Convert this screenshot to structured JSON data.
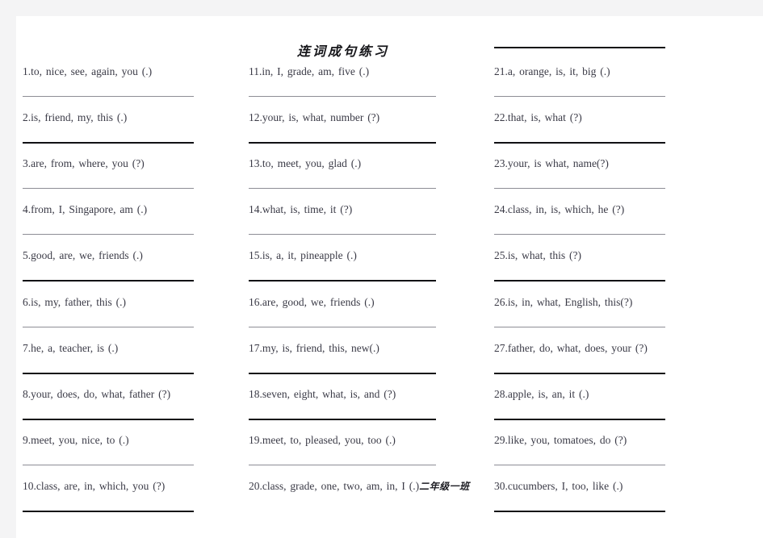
{
  "document": {
    "title": "连词成句练习",
    "page_background": "#ffffff",
    "canvas_background": "#f4f4f5",
    "text_color": "#3a3a46",
    "rule_color": "#8d8d95",
    "rule_heavy_color": "#101014"
  },
  "columns": [
    {
      "id": "column-1",
      "has_leading_rule": false,
      "has_trailing_rule": true,
      "items": [
        {
          "number": "1.",
          "text": "1.to, nice, see, again, you (.)",
          "rule": "light"
        },
        {
          "number": "2.",
          "text": "2.is, friend, my, this (.)",
          "rule": "heavy"
        },
        {
          "number": "3.",
          "text": "3.are, from, where, you (?)",
          "rule": "light"
        },
        {
          "number": "4.",
          "text": "4.from, I, Singapore, am (.)",
          "rule": "light"
        },
        {
          "number": "5.",
          "text": "5.good, are, we, friends (.)",
          "rule": "heavy"
        },
        {
          "number": "6.",
          "text": "6.is, my, father, this (.)",
          "rule": "light"
        },
        {
          "number": "7.",
          "text": "7.he, a, teacher, is (.)",
          "rule": "heavy"
        },
        {
          "number": "8.",
          "text": "8.your, does, do, what, father (?)",
          "rule": "heavy"
        },
        {
          "number": "9.",
          "text": "9.meet, you, nice, to (.)",
          "rule": "light"
        },
        {
          "number": "10.",
          "text": "10.class, are, in, which, you (?)",
          "rule": "heavy"
        }
      ]
    },
    {
      "id": "column-2",
      "has_leading_rule": false,
      "has_trailing_rule": false,
      "items": [
        {
          "number": "11.",
          "text": "11.in, I, grade, am, five (.)",
          "rule": "light"
        },
        {
          "number": "12.",
          "text": "12.your, is, what, number (?)",
          "rule": "heavy"
        },
        {
          "number": "13.",
          "text": "13.to, meet, you, glad (.)",
          "rule": "light"
        },
        {
          "number": "14.",
          "text": "14.what, is, time, it (?)",
          "rule": "light"
        },
        {
          "number": "15.",
          "text": "15.is, a, it, pineapple (.)",
          "rule": "heavy"
        },
        {
          "number": "16.",
          "text": "16.are, good, we, friends (.)",
          "rule": "light"
        },
        {
          "number": "17.",
          "text": "17.my, is, friend, this, new(.)",
          "rule": "heavy"
        },
        {
          "number": "18.",
          "text": "18.seven, eight, what, is, and (?)",
          "rule": "heavy"
        },
        {
          "number": "19.",
          "text": "19.meet, to, pleased, you, too (.)",
          "rule": "light"
        },
        {
          "number": "20.",
          "text": "20.class, grade, one, two, am, in, I (.)",
          "note": "二年级一班",
          "rule": "none"
        }
      ]
    },
    {
      "id": "column-3",
      "has_leading_rule": true,
      "has_trailing_rule": true,
      "items": [
        {
          "number": "21.",
          "text": "21.a, orange, is, it, big (.)",
          "rule": "light"
        },
        {
          "number": "22.",
          "text": "22.that, is, what (?)",
          "rule": "heavy"
        },
        {
          "number": "23.",
          "text": "23.your, is what, name(?)",
          "rule": "light"
        },
        {
          "number": "24.",
          "text": "24.class, in, is, which, he (?)",
          "rule": "light"
        },
        {
          "number": "25.",
          "text": "25.is, what, this (?)",
          "rule": "heavy"
        },
        {
          "number": "26.",
          "text": "26.is, in, what, English, this(?)",
          "rule": "light"
        },
        {
          "number": "27.",
          "text": "27.father, do, what, does, your (?)",
          "rule": "heavy"
        },
        {
          "number": "28.",
          "text": "28.apple, is, an, it (.)",
          "rule": "heavy"
        },
        {
          "number": "29.",
          "text": "29.like, you, tomatoes, do (?)",
          "rule": "light"
        },
        {
          "number": "30.",
          "text": "30.cucumbers, I, too, like (.)",
          "rule": "heavy"
        }
      ]
    }
  ]
}
